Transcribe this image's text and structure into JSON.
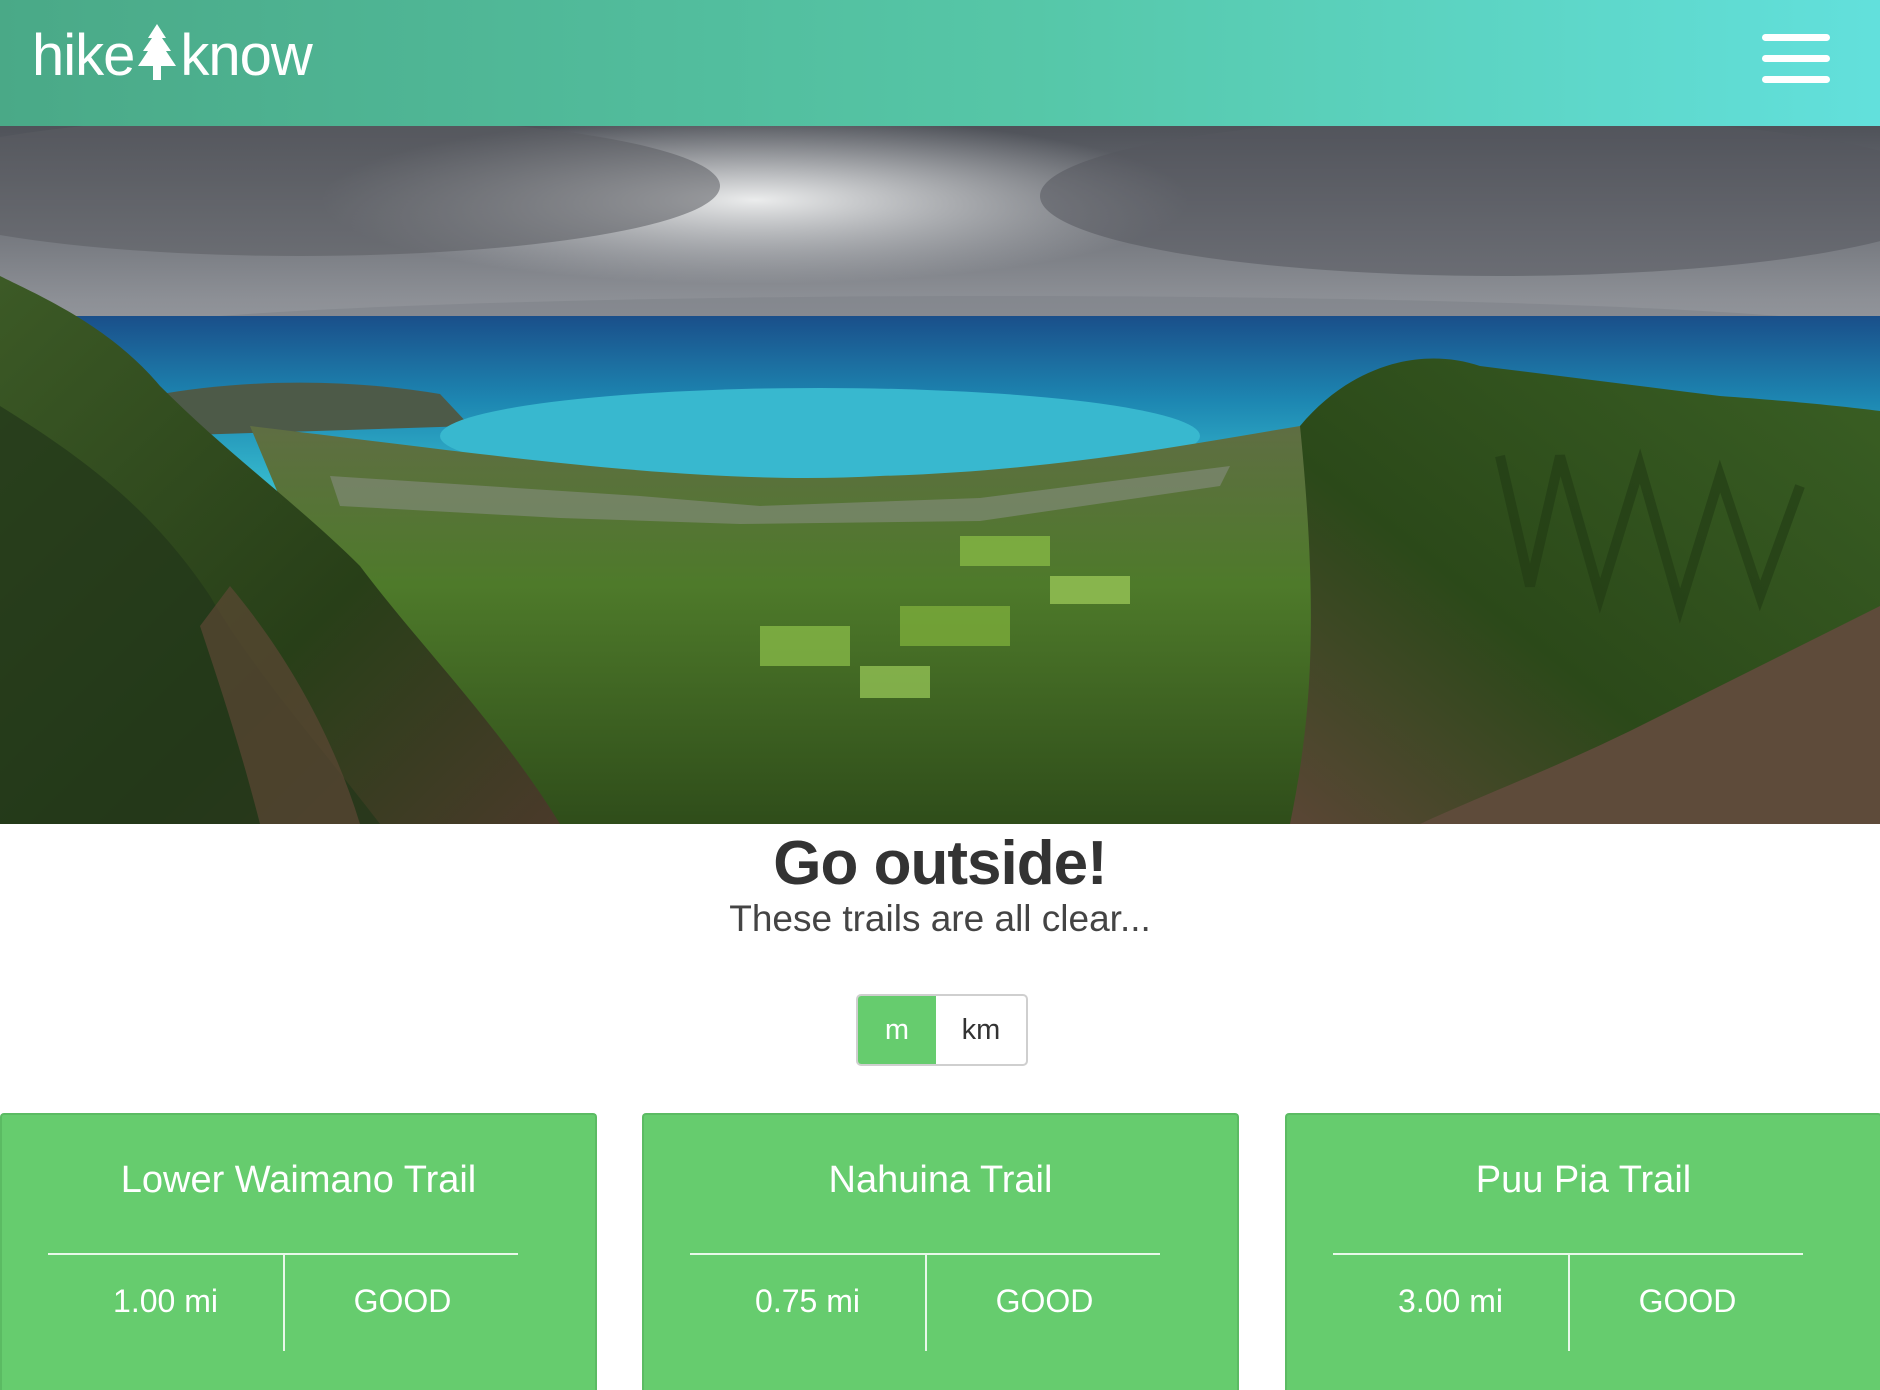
{
  "header": {
    "logo_left": "hike",
    "logo_right": "know",
    "logo_icon": "pine-tree-icon",
    "menu_icon": "hamburger-menu-icon",
    "gradient_start": "#4aa987",
    "gradient_end": "#62e0dc"
  },
  "hero": {
    "image": "mountain-valley-coastline-photo"
  },
  "main": {
    "headline": "Go outside!",
    "subheadline": "These trails are all clear..."
  },
  "units": {
    "options": [
      "m",
      "km"
    ],
    "selected": "m",
    "accent": "#66cc6e"
  },
  "trails": [
    {
      "name": "Lower Waimano Trail",
      "distance": "1.00 mi",
      "condition": "GOOD"
    },
    {
      "name": "Nahuina Trail",
      "distance": "0.75 mi",
      "condition": "GOOD"
    },
    {
      "name": "Puu Pia Trail",
      "distance": "3.00 mi",
      "condition": "GOOD"
    }
  ]
}
